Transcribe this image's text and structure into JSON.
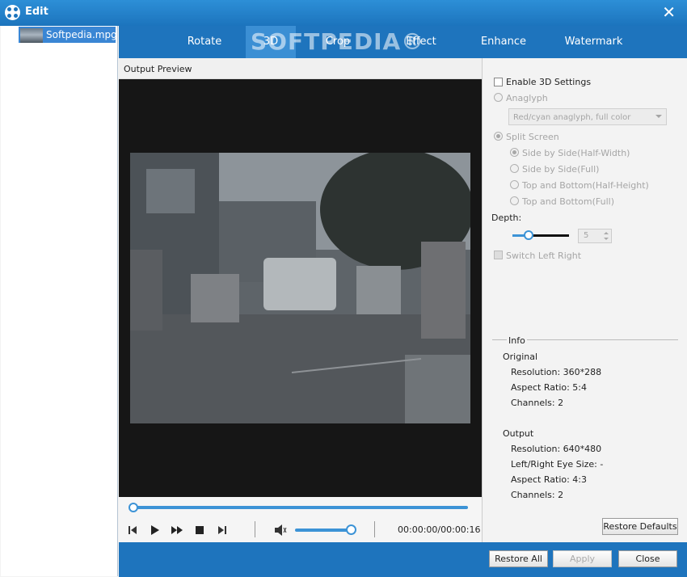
{
  "window": {
    "title": "Edit",
    "close_label": "✕"
  },
  "file_list": {
    "items": [
      {
        "name": "Softpedia.mpg"
      }
    ]
  },
  "tabs": [
    {
      "label": "Rotate",
      "active": false
    },
    {
      "label": "3D",
      "active": true
    },
    {
      "label": "Crop",
      "active": false
    },
    {
      "label": "Effect",
      "active": false
    },
    {
      "label": "Enhance",
      "active": false
    },
    {
      "label": "Watermark",
      "active": false
    }
  ],
  "watermark_text": "SOFTPEDIA®",
  "preview": {
    "label": "Output Preview",
    "seek_progress": 0.0
  },
  "player": {
    "timecode": "00:00:00/00:00:16",
    "volume_level": 1.0
  },
  "settings_3d": {
    "enable_label": "Enable 3D Settings",
    "enable_checked": false,
    "anaglyph_label": "Anaglyph",
    "anaglyph_option": "Red/cyan anaglyph, full color",
    "split_screen_label": "Split Screen",
    "split_options": [
      {
        "label": "Side by Side(Half-Width)",
        "selected": true
      },
      {
        "label": "Side by Side(Full)",
        "selected": false
      },
      {
        "label": "Top and Bottom(Half-Height)",
        "selected": false
      },
      {
        "label": "Top and Bottom(Full)",
        "selected": false
      }
    ],
    "depth_label": "Depth:",
    "depth_value": "5",
    "switch_label": "Switch Left Right"
  },
  "info": {
    "title": "Info",
    "original_label": "Original",
    "original": {
      "resolution": "Resolution: 360*288",
      "aspect": "Aspect Ratio: 5:4",
      "channels": "Channels: 2"
    },
    "output_label": "Output",
    "output": {
      "resolution": "Resolution: 640*480",
      "eye_size": "Left/Right Eye Size: -",
      "aspect": "Aspect Ratio: 4:3",
      "channels": "Channels: 2"
    }
  },
  "buttons": {
    "restore_defaults": "Restore Defaults",
    "restore_all": "Restore All",
    "apply": "Apply",
    "close": "Close"
  },
  "colors": {
    "title_bar": "#1c74bd",
    "accent": "#3c93d6",
    "tab_bar": "#1e74bd"
  }
}
